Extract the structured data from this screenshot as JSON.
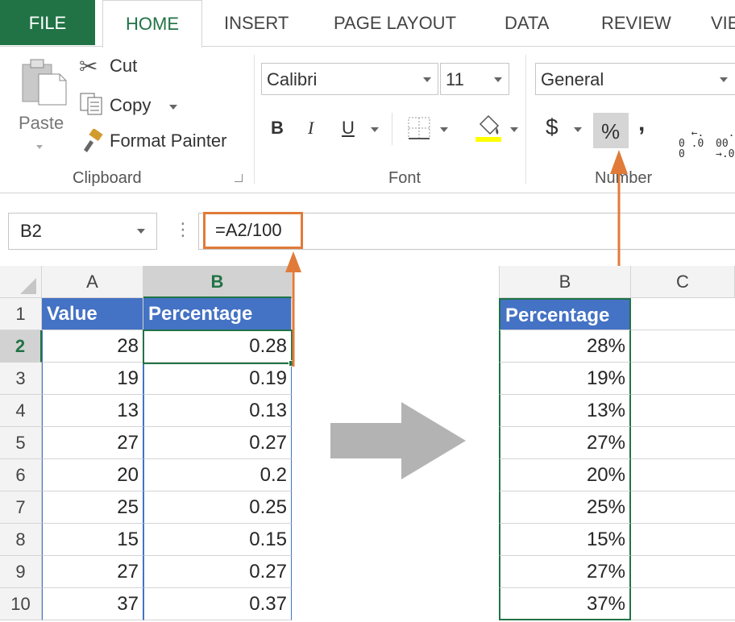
{
  "ribbon": {
    "tabs": [
      "FILE",
      "HOME",
      "INSERT",
      "PAGE LAYOUT",
      "DATA",
      "REVIEW",
      "VIE"
    ],
    "clipboard": {
      "paste": "Paste",
      "cut": "Cut",
      "copy": "Copy",
      "format_painter": "Format Painter",
      "label": "Clipboard"
    },
    "font": {
      "name": "Calibri",
      "size": "11",
      "bold": "B",
      "italic": "I",
      "underline": "U",
      "label": "Font"
    },
    "number": {
      "format": "General",
      "currency": "$",
      "percent": "%",
      "comma": ",",
      "dec_increase": "←.0 .00",
      "dec_decrease": ".00 →.0",
      "label": "Number"
    }
  },
  "formula_bar": {
    "name_box": "B2",
    "colon": "⋮",
    "formula": "=A2/100"
  },
  "sheet": {
    "columns": [
      "A",
      "B"
    ],
    "headers": [
      "Value",
      "Percentage"
    ],
    "row_numbers": [
      "1",
      "2",
      "3",
      "4",
      "5",
      "6",
      "7",
      "8",
      "9",
      "10"
    ],
    "values": [
      "28",
      "19",
      "13",
      "27",
      "20",
      "25",
      "15",
      "27",
      "37"
    ],
    "decimals": [
      "0.28",
      "0.19",
      "0.13",
      "0.27",
      "0.2",
      "0.25",
      "0.15",
      "0.27",
      "0.37"
    ]
  },
  "result": {
    "columns": [
      "B",
      "C"
    ],
    "header": "Percentage",
    "percents": [
      "28%",
      "19%",
      "13%",
      "27%",
      "20%",
      "25%",
      "15%",
      "27%",
      "37%"
    ]
  },
  "colors": {
    "excel_green": "#217346",
    "header_blue": "#4472c4",
    "highlight_orange": "#e07b39",
    "arrow_gray": "#b3b3b3"
  }
}
